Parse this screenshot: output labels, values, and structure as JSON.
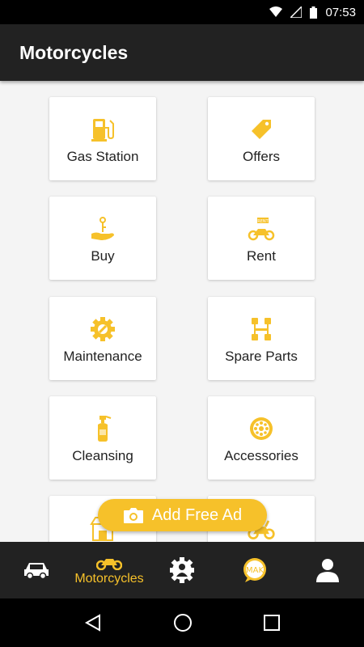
{
  "status_bar": {
    "time": "07:53"
  },
  "app_bar": {
    "title": "Motorcycles"
  },
  "colors": {
    "accent": "#f6c12a",
    "bar": "#222222"
  },
  "categories": [
    {
      "label": "Gas Station",
      "icon": "gas-pump-icon"
    },
    {
      "label": "Offers",
      "icon": "price-tag-icon"
    },
    {
      "label": "Buy",
      "icon": "hand-key-icon"
    },
    {
      "label": "Rent",
      "icon": "rent-motorcycle-icon"
    },
    {
      "label": "Maintenance",
      "icon": "gear-wrench-icon"
    },
    {
      "label": "Spare Parts",
      "icon": "spare-parts-icon"
    },
    {
      "label": "Cleansing",
      "icon": "spray-bottle-icon"
    },
    {
      "label": "Accessories",
      "icon": "wheel-icon"
    },
    {
      "label": "",
      "icon": "shop-icon"
    },
    {
      "label": "",
      "icon": "motorcycle-icon"
    }
  ],
  "fab": {
    "label": "Add Free Ad",
    "icon": "camera-icon"
  },
  "bottom_nav": [
    {
      "label": "",
      "icon": "car-icon"
    },
    {
      "label": "Motorcycles",
      "icon": "motorcycle-icon"
    },
    {
      "label": "",
      "icon": "gear-person-icon"
    },
    {
      "label": "",
      "icon": "mak-chat-icon",
      "badge": "MAK"
    },
    {
      "label": "",
      "icon": "profile-icon"
    }
  ]
}
